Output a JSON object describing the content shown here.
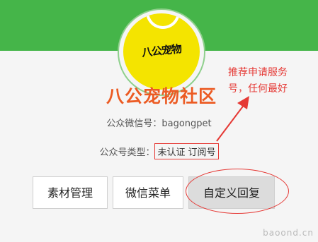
{
  "account": {
    "logo_text": "八公宠物",
    "name": "八公宠物社区",
    "wechat_id_label": "公众微信号：",
    "wechat_id_value": "bagongpet",
    "type_label": "公众号类型：",
    "type_values": [
      "未认证",
      "订阅号"
    ]
  },
  "actions": {
    "material_label": "素材管理",
    "menu_label": "微信菜单",
    "reply_label": "自定义回复"
  },
  "annotation": {
    "line1": "推荐申请服务",
    "line2": "号，任何最好"
  },
  "watermark": "baoond.cn",
  "colors": {
    "header_green": "#45b549",
    "name_orange": "#ec5b23",
    "annotation_red": "#e53935",
    "avatar_yellow": "#f4e400"
  }
}
